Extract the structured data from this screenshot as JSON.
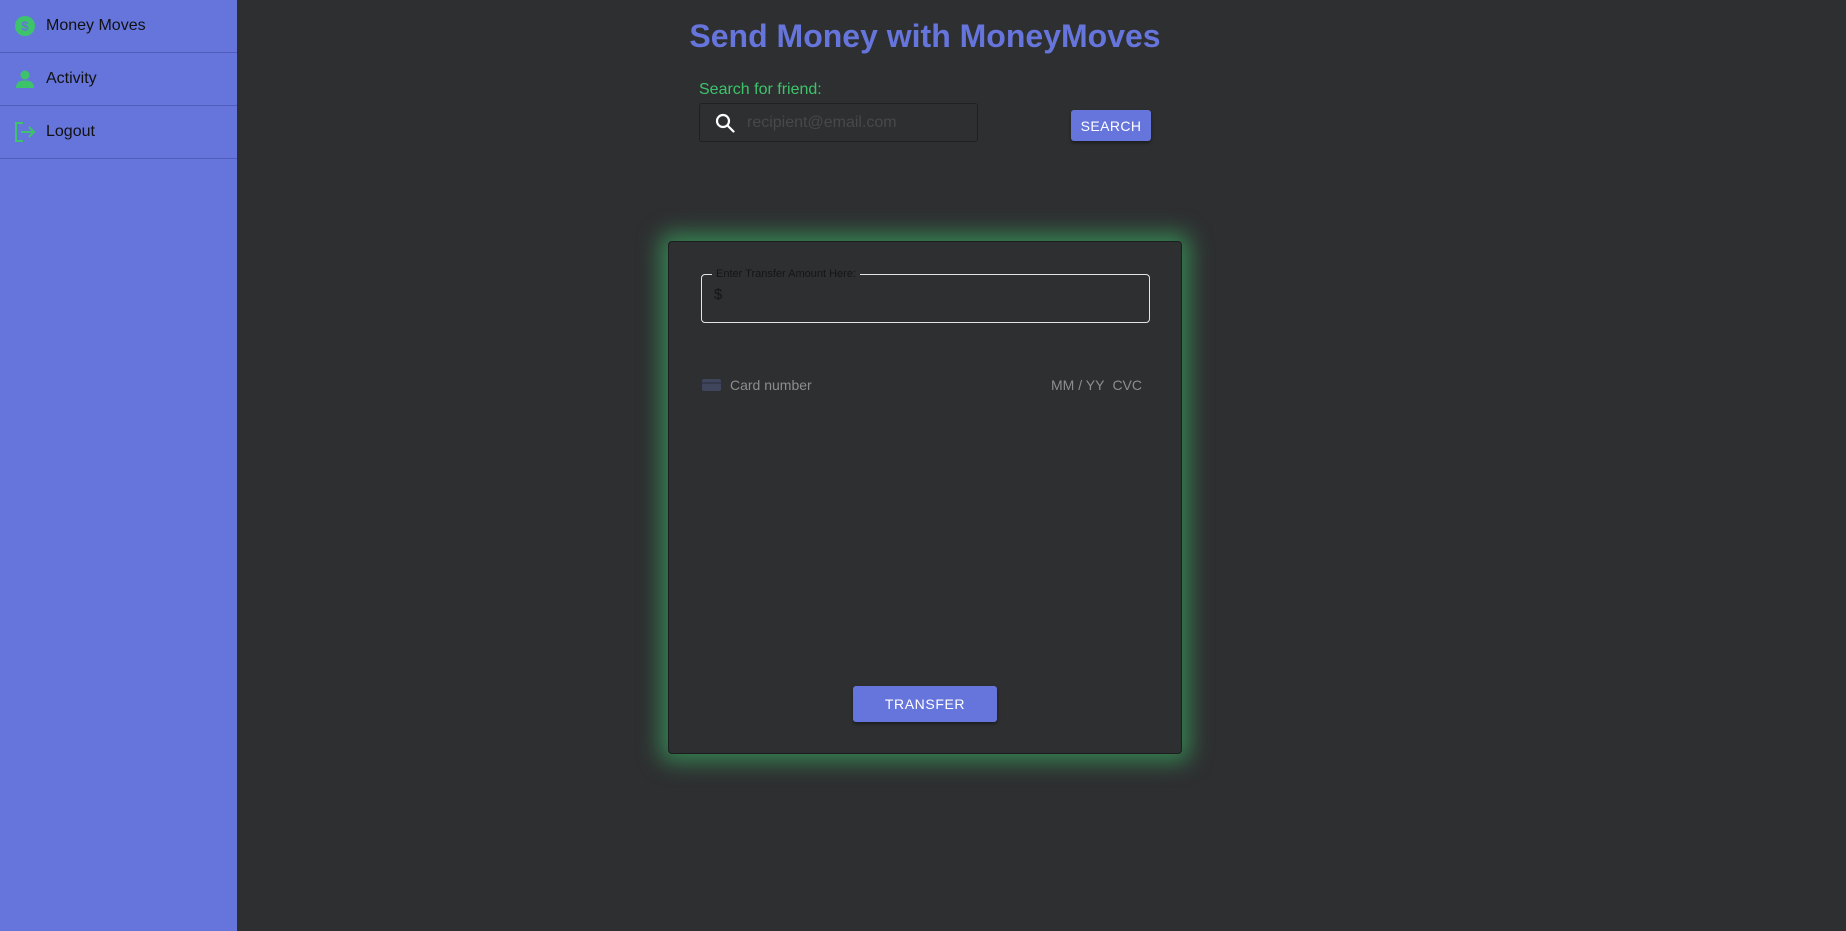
{
  "sidebar": {
    "items": [
      {
        "label": "Money Moves",
        "icon": "dollar-circle-icon"
      },
      {
        "label": "Activity",
        "icon": "person-icon"
      },
      {
        "label": "Logout",
        "icon": "logout-icon"
      }
    ]
  },
  "header": {
    "title": "Send Money with MoneyMoves"
  },
  "search": {
    "label": "Search for friend:",
    "placeholder": "recipient@email.com",
    "value": "",
    "button_label": "SEARCH"
  },
  "transfer_card": {
    "amount_label": "Enter Transfer Amount Here:",
    "currency_symbol": "$",
    "amount_value": "",
    "card_number_placeholder": "Card number",
    "expiry_placeholder": "MM / YY",
    "cvc_placeholder": "CVC",
    "button_label": "TRANSFER"
  },
  "colors": {
    "accent": "#6675dc",
    "success": "#3dc46b",
    "background": "#2e2f31"
  }
}
